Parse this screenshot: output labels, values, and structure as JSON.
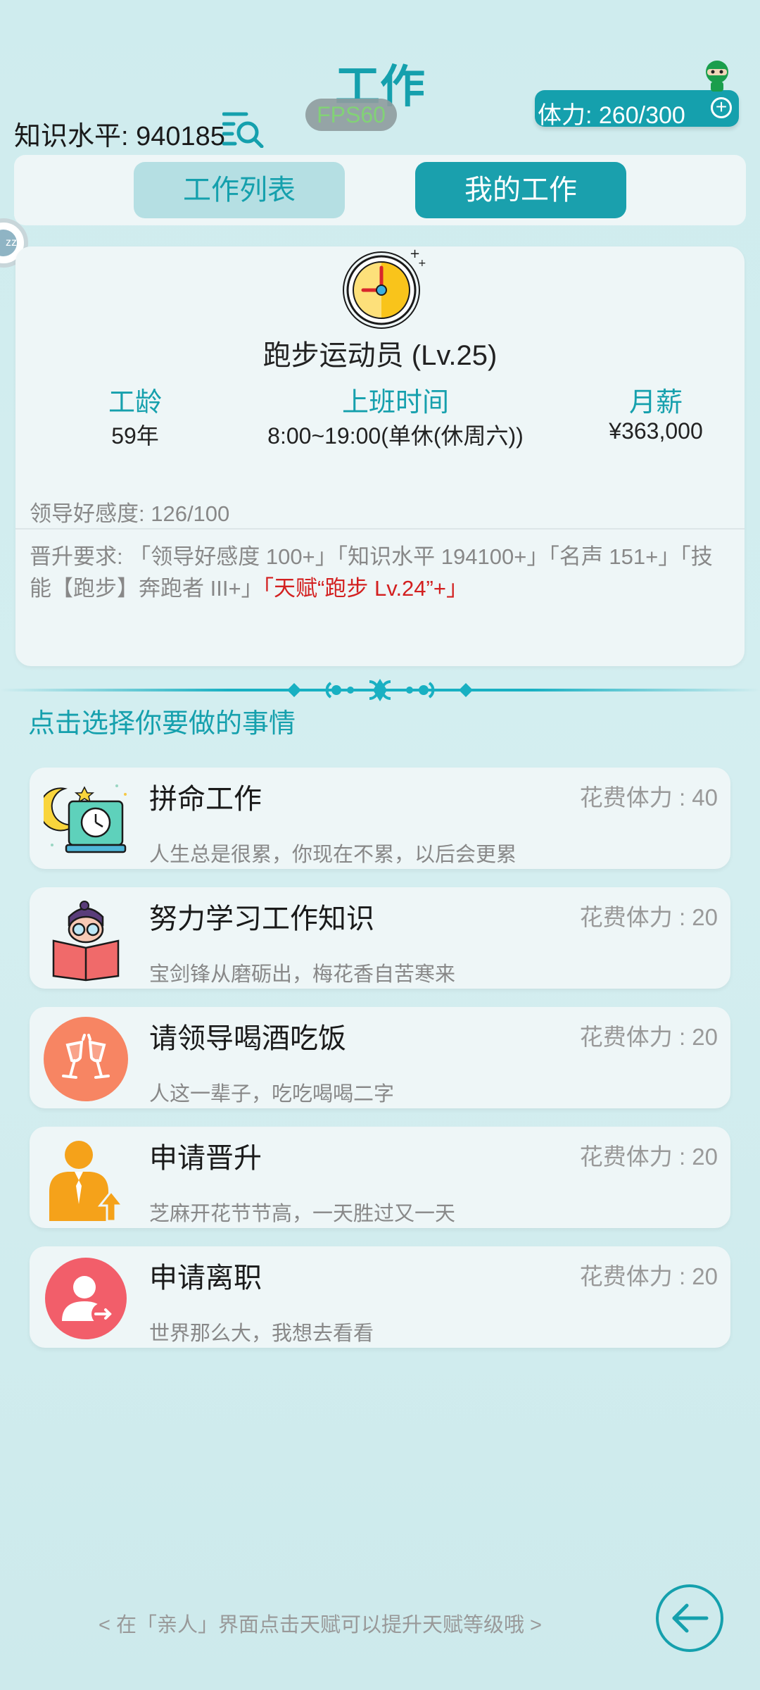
{
  "header": {
    "title": "工作",
    "fps": "FPS60",
    "knowledge": "知识水平: 940185",
    "stamina": "体力: 260/300",
    "stamina_plus": "+"
  },
  "tabs": [
    {
      "label": "工作列表",
      "active": false
    },
    {
      "label": "我的工作",
      "active": true
    }
  ],
  "side_float_label": "zz",
  "job": {
    "title": "跑步运动员 (Lv.25)",
    "stats": [
      {
        "label": "工龄",
        "value": "59年"
      },
      {
        "label": "上班时间",
        "value": "8:00~19:00(单休(休周六))"
      },
      {
        "label": "月薪",
        "value": "¥363,000"
      }
    ],
    "favor": "领导好感度: 126/100",
    "promotion_prefix": "晋升要求: 「领导好感度 100+」「知识水平 194100+」「名声 151+」「技能【跑步】奔跑者 III+」",
    "promotion_highlight": "「天赋“跑步 Lv.24”+」"
  },
  "choose_title": "点击选择你要做的事情",
  "actions": [
    {
      "title": "拼命工作",
      "cost": "花费体力 : 40",
      "subtitle": "人生总是很累，你现在不累，以后会更累",
      "icon": "night-work-icon"
    },
    {
      "title": "努力学习工作知识",
      "cost": "花费体力 : 20",
      "subtitle": "宝剑锋从磨砺出，梅花香自苦寒来",
      "icon": "study-icon"
    },
    {
      "title": "请领导喝酒吃饭",
      "cost": "花费体力 : 20",
      "subtitle": "人这一辈子，吃吃喝喝二字",
      "icon": "toast-icon"
    },
    {
      "title": "申请晋升",
      "cost": "花费体力 : 20",
      "subtitle": "芝麻开花节节高，一天胜过又一天",
      "icon": "promotion-icon"
    },
    {
      "title": "申请离职",
      "cost": "花费体力 : 20",
      "subtitle": "世界那么大，我想去看看",
      "icon": "resign-icon"
    }
  ],
  "footer_hint": "< 在「亲人」界面点击天赋可以提升天赋等级哦 >",
  "colors": {
    "accent": "#15a0ad",
    "highlight": "#d32020",
    "background": "#cfecee"
  }
}
